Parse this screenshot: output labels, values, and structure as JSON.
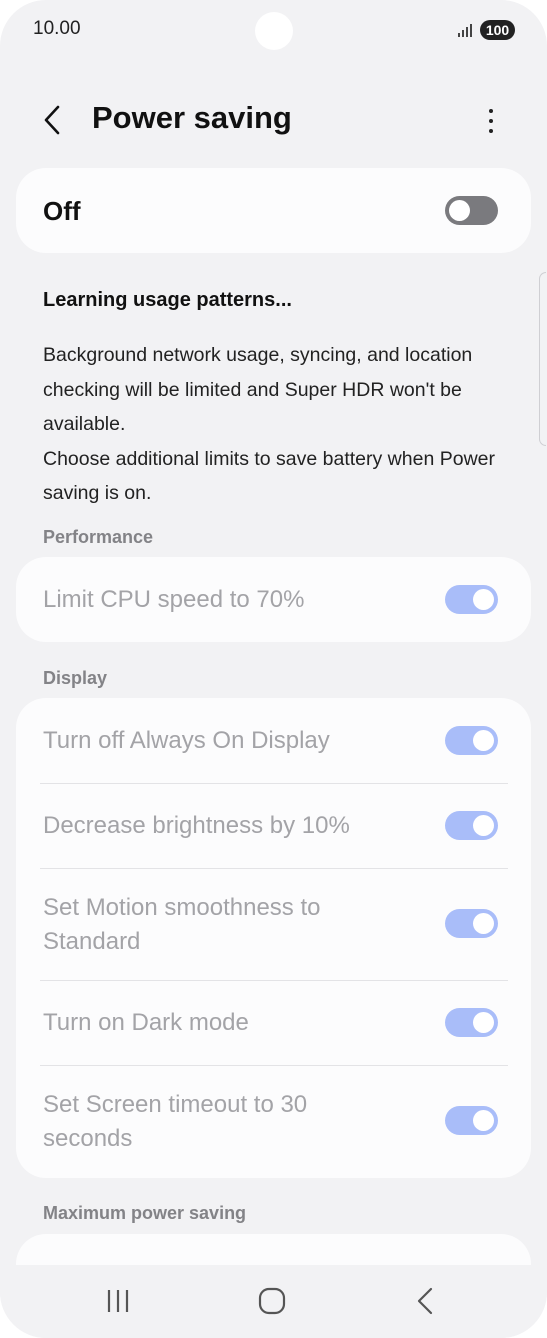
{
  "status_bar": {
    "time": "10.00",
    "battery": "100"
  },
  "header": {
    "title": "Power saving",
    "back_icon": "chevron-left-icon",
    "more_icon": "more-vertical-icon"
  },
  "master": {
    "label": "Off",
    "enabled": false
  },
  "info": {
    "title": "Learning usage patterns...",
    "paragraphs": [
      "Background network usage, syncing, and location checking will be limited and Super HDR won't be available.",
      "Choose additional limits to save battery when Power saving is on."
    ]
  },
  "sections": {
    "performance": {
      "header": "Performance",
      "items": [
        {
          "label": "Limit CPU speed to 70%",
          "enabled": true
        }
      ]
    },
    "display": {
      "header": "Display",
      "items": [
        {
          "label": "Turn off Always On Display",
          "enabled": true
        },
        {
          "label": "Decrease brightness by 10%",
          "enabled": true
        },
        {
          "label": "Set Motion smoothness to Standard",
          "enabled": true
        },
        {
          "label": "Turn on Dark mode",
          "enabled": true
        },
        {
          "label": "Set Screen timeout to 30 seconds",
          "enabled": true
        }
      ]
    },
    "maximum": {
      "header": "Maximum power saving"
    }
  },
  "nav_bar": {
    "recents_icon": "recents-icon",
    "home_icon": "home-icon",
    "back_icon": "back-icon"
  },
  "colors": {
    "background": "#f2f2f4",
    "card": "#fcfcfd",
    "toggle_on": "#a9bdf9",
    "toggle_off": "#7a7a7e",
    "disabled_text": "#a3a3a7"
  }
}
